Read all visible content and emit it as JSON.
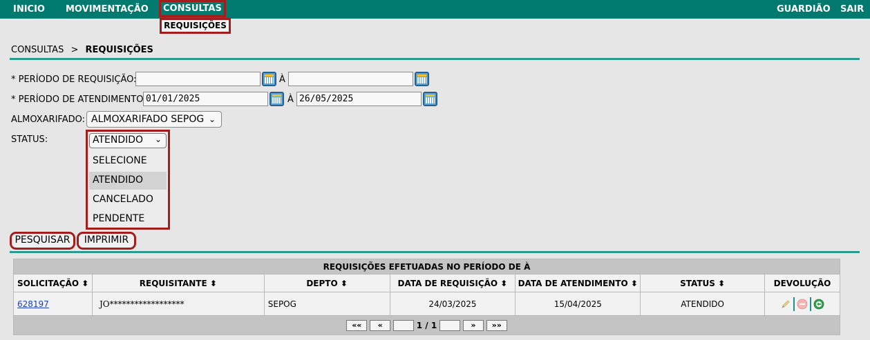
{
  "nav": {
    "inicio": "INICIO",
    "movimentacao": "MOVIMENTAÇÃO",
    "consultas": "CONSULTAS",
    "submenu_requisicoes": "REQUISIÇÕES",
    "guardiao": "GUARDIÃO",
    "sair": "SAIR"
  },
  "breadcrumb": {
    "parent": "CONSULTAS",
    "separator": ">",
    "current": "REQUISIÇÕES"
  },
  "form": {
    "periodo_requisicao_label": "* PERÍODO DE REQUISIÇÃO:",
    "periodo_requisicao_inicio": "",
    "periodo_requisicao_fim": "",
    "periodo_atendimento_label": "* PERÍODO DE ATENDIMENTO:",
    "periodo_atendimento_inicio": "01/01/2025",
    "periodo_atendimento_fim": "26/05/2025",
    "to_label": "À",
    "almoxarifado_label": "ALMOXARIFADO:",
    "almoxarifado_value": "ALMOXARIFADO SEPOG",
    "status_label": "STATUS:",
    "status_value": "ATENDIDO",
    "status_options": [
      "SELECIONE",
      "ATENDIDO",
      "CANCELADO",
      "PENDENTE"
    ]
  },
  "buttons": {
    "pesquisar": "PESQUISAR",
    "imprimir": "IMPRIMIR"
  },
  "table": {
    "caption": "REQUISIÇÕES EFETUADAS NO PERÍODO DE À",
    "columns": [
      "SOLICITAÇÃO ⬍",
      "REQUISITANTE ⬍",
      "DEPTO ⬍",
      "DATA DE REQUISIÇÃO ⬍",
      "DATA DE ATENDIMENTO ⬍",
      "STATUS ⬍",
      "DEVOLUÇÃO"
    ],
    "rows": [
      {
        "solicitacao": "628197",
        "requisitante": "JO******************",
        "depto": "SEPOG",
        "data_requisicao": "24/03/2025",
        "data_atendimento": "15/04/2025",
        "status": "ATENDIDO"
      }
    ],
    "pager": {
      "first": "««",
      "prev": "«",
      "page": "1 / 1",
      "next": "»",
      "last": "»»"
    }
  },
  "colors": {
    "topbar": "#007a6e",
    "highlight": "#a31d1d",
    "rule": "#2a9a8f",
    "link": "#1a3fbf"
  },
  "icons": [
    "calendar-icon",
    "chevron-down-icon",
    "edit-icon",
    "cancel-icon",
    "return-icon"
  ]
}
